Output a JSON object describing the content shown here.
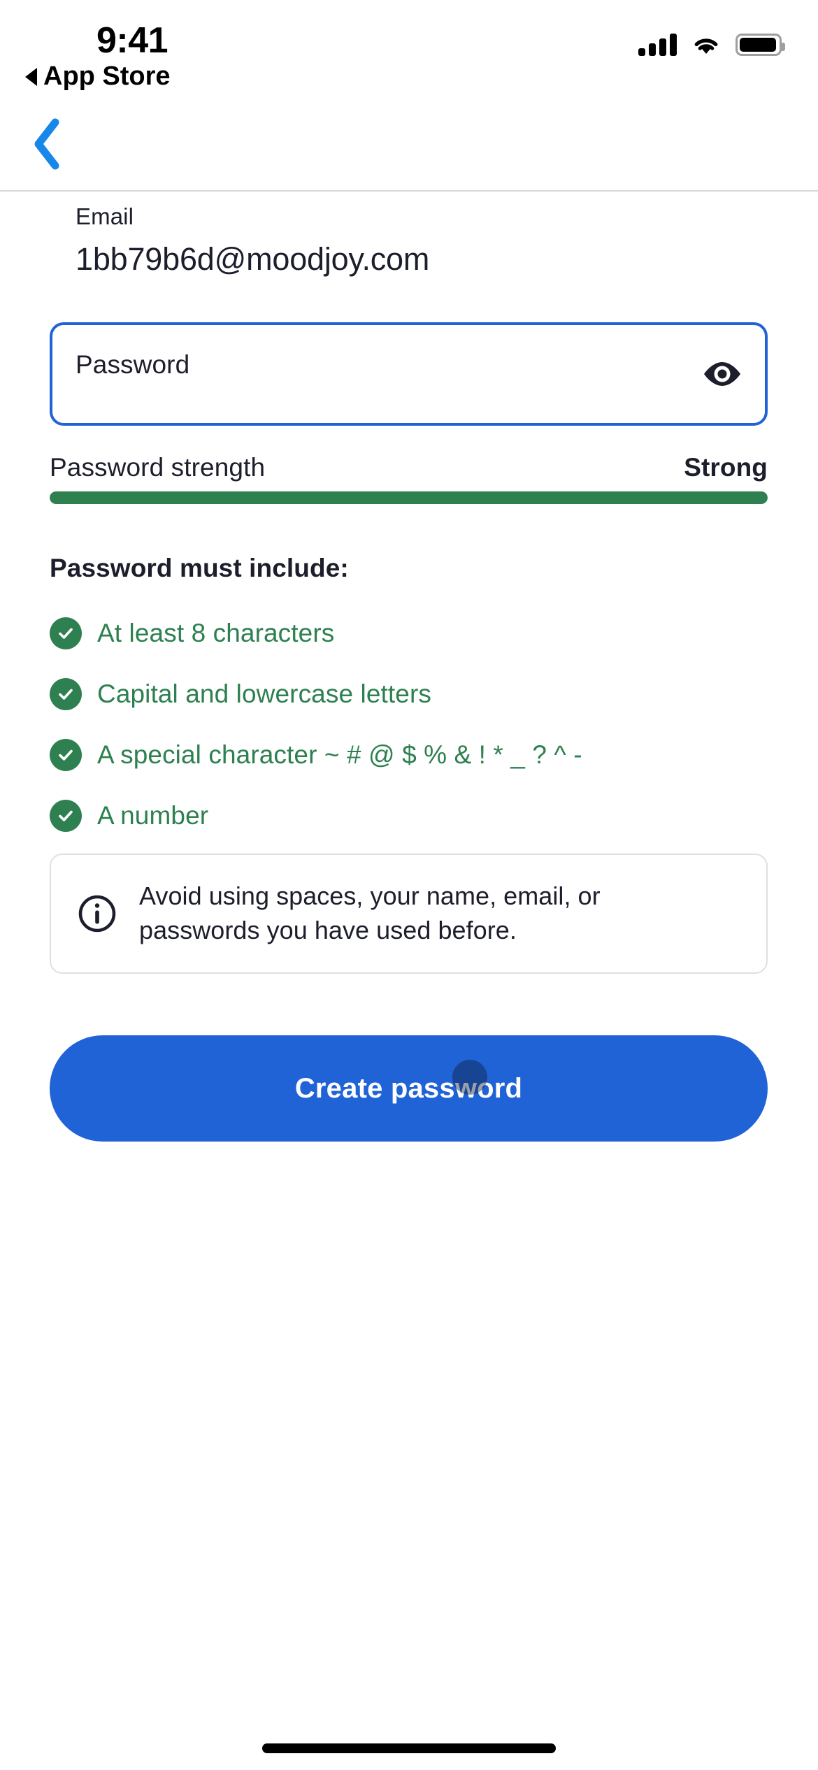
{
  "status_bar": {
    "time": "9:41",
    "back_app_label": "App Store",
    "back_app_icon": "back-triangle-icon",
    "signal_icon": "cellular-signal-icon",
    "wifi_icon": "wifi-icon",
    "battery_icon": "battery-full-icon"
  },
  "nav": {
    "back_icon": "chevron-left-icon"
  },
  "form": {
    "email_label": "Email",
    "email_value": "1bb79b6d@moodjoy.com",
    "password_placeholder": "Password",
    "password_value": "",
    "show_password_icon": "eye-icon"
  },
  "strength": {
    "label": "Password strength",
    "value": "Strong",
    "percent": 100,
    "bar_color": "#2e8050"
  },
  "requirements": {
    "heading": "Password must include:",
    "items": [
      {
        "label": "At least 8 characters",
        "met": true,
        "icon": "check-circle-icon"
      },
      {
        "label": "Capital and lowercase letters",
        "met": true,
        "icon": "check-circle-icon"
      },
      {
        "label": "A special character ~ # @ $ % & ! * _ ? ^ -",
        "met": true,
        "icon": "check-circle-icon"
      },
      {
        "label": "A number",
        "met": true,
        "icon": "check-circle-icon"
      }
    ]
  },
  "info": {
    "icon": "info-circle-icon",
    "line1": "Avoid using spaces, your name, email, or",
    "line2": "passwords you have used before."
  },
  "actions": {
    "primary_label": "Create password"
  },
  "colors": {
    "accent_blue": "#2063d6",
    "success_green": "#2e8050",
    "text_dark": "#1d1e2c",
    "border_light": "#e0e0e4"
  }
}
